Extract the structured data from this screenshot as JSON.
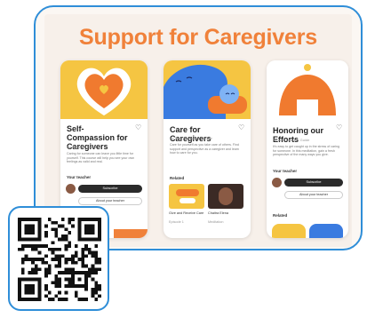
{
  "headline": "Support for Caregivers",
  "colors": {
    "accent": "#f0813a",
    "frame": "#2f8ed8",
    "hero_yellow": "#f5c542",
    "hero_blue": "#3a7be0",
    "orange": "#f0813a"
  },
  "cards": [
    {
      "title": "Self-Compassion for Caregivers",
      "meta": "By Sal Kim · Guide",
      "desc": "Caring for someone can leave you little time for yourself. This course will help you see your own feelings as valid and real.",
      "teacher_label": "Your teacher",
      "primary_button": "Subscribe",
      "secondary_button": "About your teacher"
    },
    {
      "title": "Care for Caregivers",
      "meta": "By Sara Rodriguez · Guide",
      "desc": "Care for yourself as you take care of others. Find support and perspective as a caregiver and learn how to care for you.",
      "related_label": "Related",
      "related": [
        {
          "caption": "Give and Receive Care",
          "sub": "Episode 1"
        },
        {
          "caption": "Chaitra Elena",
          "sub": "Meditation"
        }
      ]
    },
    {
      "title": "Honoring our Efforts",
      "meta": "By Amy Nelson · Guide",
      "desc": "It's easy to get caught up in the stress of caring for someone. In this meditation, gain a fresh perspective of the many ways you give.",
      "teacher_label": "Your teacher",
      "primary_button": "Subscribe",
      "secondary_button": "About your teacher",
      "related_label": "Related"
    }
  ],
  "icons": {
    "heart": "heart-outline-icon",
    "qr": "qr-code-icon"
  }
}
